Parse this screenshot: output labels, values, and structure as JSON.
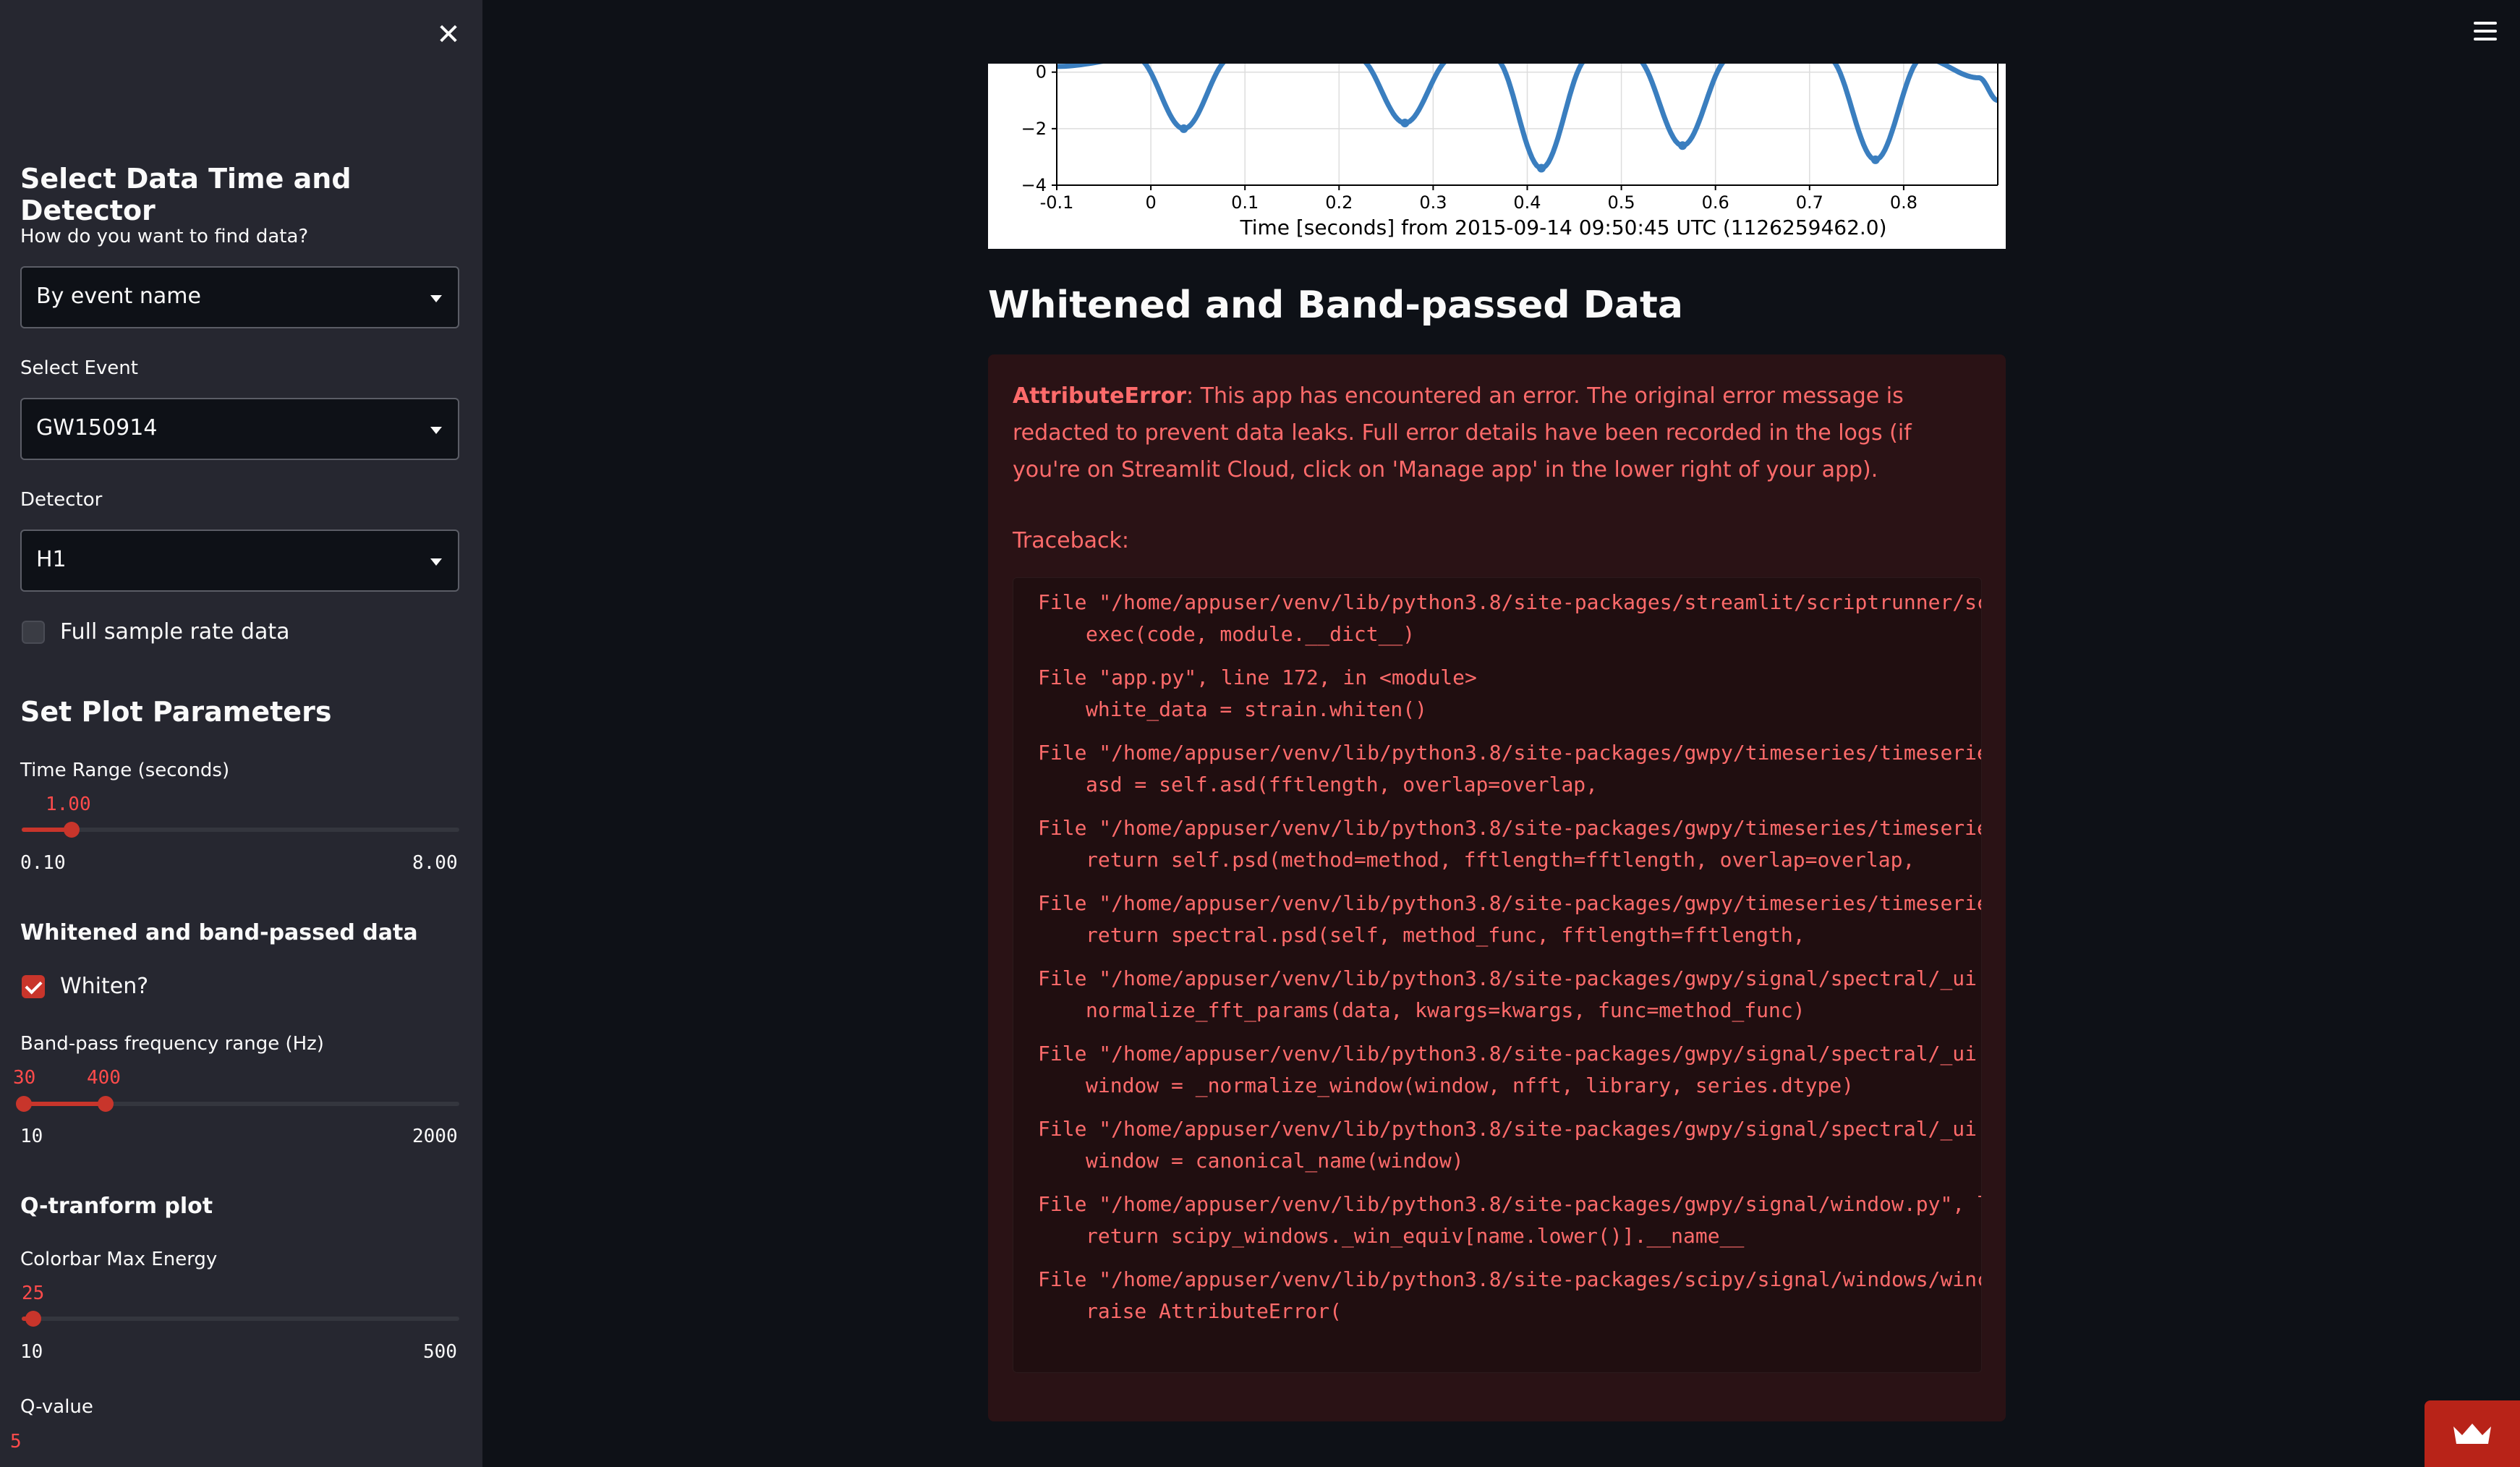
{
  "sidebar": {
    "section1_title": "Select Data Time and Detector",
    "find_label": "How do you want to find data?",
    "find_value": "By event name",
    "event_label": "Select Event",
    "event_value": "GW150914",
    "detector_label": "Detector",
    "detector_value": "H1",
    "fullrate_label": "Full sample rate data",
    "fullrate_checked": false,
    "section2_title": "Set Plot Parameters",
    "timerange_label": "Time Range (seconds)",
    "timerange_value": "1.00",
    "timerange_min": "0.10",
    "timerange_max": "8.00",
    "timerange_fraction": 0.114,
    "whiten_heading": "Whitened and band-passed data",
    "whiten_label": "Whiten?",
    "whiten_checked": true,
    "bandpass_label": "Band-pass frequency range (Hz)",
    "bandpass_low": "30",
    "bandpass_high": "400",
    "bandpass_min": "10",
    "bandpass_max": "2000",
    "bandpass_low_fraction": 0.01,
    "bandpass_high_fraction": 0.196,
    "qplot_heading": "Q-tranform plot",
    "colorbar_label": "Colorbar Max Energy",
    "colorbar_value": "25",
    "colorbar_min": "10",
    "colorbar_max": "500",
    "colorbar_fraction": 0.031,
    "qvalue_label": "Q-value",
    "qvalue_value": "5"
  },
  "main": {
    "section_title": "Whitened and Band-passed Data",
    "error": {
      "type": "AttributeError",
      "message": ": This app has encountered an error. The original error message is redacted to prevent data leaks. Full error details have been recorded in the logs (if you're on Streamlit Cloud, click on 'Manage app' in the lower right of your app).",
      "traceback_label": "Traceback:",
      "frames": [
        {
          "file": "File \"/home/appuser/venv/lib/python3.8/site-packages/streamlit/scriptrunner/sc",
          "code": "exec(code, module.__dict__)"
        },
        {
          "file": "File \"app.py\", line 172, in <module>",
          "code": "white_data = strain.whiten()"
        },
        {
          "file": "File \"/home/appuser/venv/lib/python3.8/site-packages/gwpy/timeseries/timeserie",
          "code": "asd = self.asd(fftlength, overlap=overlap,"
        },
        {
          "file": "File \"/home/appuser/venv/lib/python3.8/site-packages/gwpy/timeseries/timeserie",
          "code": "return self.psd(method=method, fftlength=fftlength, overlap=overlap,"
        },
        {
          "file": "File \"/home/appuser/venv/lib/python3.8/site-packages/gwpy/timeseries/timeserie",
          "code": "return spectral.psd(self, method_func, fftlength=fftlength,"
        },
        {
          "file": "File \"/home/appuser/venv/lib/python3.8/site-packages/gwpy/signal/spectral/_ui.",
          "code": "normalize_fft_params(data, kwargs=kwargs, func=method_func)"
        },
        {
          "file": "File \"/home/appuser/venv/lib/python3.8/site-packages/gwpy/signal/spectral/_ui.",
          "code": "window = _normalize_window(window, nfft, library, series.dtype)"
        },
        {
          "file": "File \"/home/appuser/venv/lib/python3.8/site-packages/gwpy/signal/spectral/_ui.",
          "code": "window = canonical_name(window)"
        },
        {
          "file": "File \"/home/appuser/venv/lib/python3.8/site-packages/gwpy/signal/window.py\", l",
          "code": "return scipy_windows._win_equiv[name.lower()].__name__"
        },
        {
          "file": "File \"/home/appuser/venv/lib/python3.8/site-packages/scipy/signal/windows/winc",
          "code": "raise AttributeError("
        }
      ]
    }
  },
  "chart_data": {
    "type": "line",
    "xlabel": "Time [seconds] from 2015-09-14 09:50:45 UTC (1126259462.0)",
    "ylabel": "",
    "xticks": [
      "-0.1",
      "0",
      "0.1",
      "0.2",
      "0.3",
      "0.4",
      "0.5",
      "0.6",
      "0.7",
      "0.8"
    ],
    "yticks": [
      "0",
      "−2",
      "−4"
    ],
    "xlim": [
      -0.1,
      0.9
    ],
    "ylim": [
      -4,
      0.3
    ],
    "line_color": "#3a7ebf",
    "minima": [
      {
        "x": 0.035,
        "y": -2.0
      },
      {
        "x": 0.27,
        "y": -1.8
      },
      {
        "x": 0.415,
        "y": -3.4
      },
      {
        "x": 0.565,
        "y": -2.6
      },
      {
        "x": 0.77,
        "y": -3.1
      }
    ]
  }
}
